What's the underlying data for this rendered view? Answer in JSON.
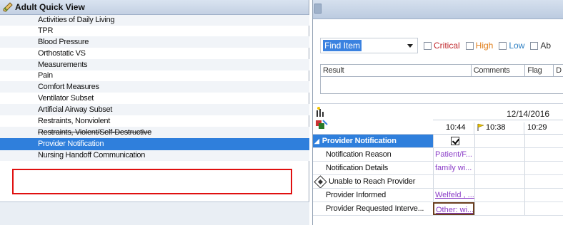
{
  "left_panel": {
    "title": "Adult Quick View",
    "items": [
      {
        "label": "Activities of Daily Living"
      },
      {
        "label": "TPR"
      },
      {
        "label": "Blood Pressure"
      },
      {
        "label": "Orthostatic VS"
      },
      {
        "label": "Measurements"
      },
      {
        "label": "Pain"
      },
      {
        "label": "Comfort Measures"
      },
      {
        "label": "Ventilator Subset"
      },
      {
        "label": "Artificial Airway Subset"
      },
      {
        "label": "Restraints, Nonviolent"
      },
      {
        "label": "Restraints, Violent/Self-Destructive"
      },
      {
        "label": "Provider Notification"
      },
      {
        "label": "Nursing Handoff Communication"
      }
    ],
    "selected_index": 11
  },
  "right_panel": {
    "find": {
      "value": "Find Item"
    },
    "filters": [
      "Critical",
      "High",
      "Low",
      "Ab"
    ],
    "result_columns": [
      "Result",
      "Comments",
      "Flag",
      "D"
    ],
    "grid": {
      "date": "12/14/2016",
      "times": [
        "10:44",
        "10:38",
        "10:29"
      ],
      "section": "Provider Notification",
      "rows": [
        {
          "label": "Notification Reason",
          "value": "Patient/F..."
        },
        {
          "label": "Notification Details",
          "value": "family wi..."
        },
        {
          "label": "Unable to Reach Provider",
          "value": ""
        },
        {
          "label": "Provider Informed",
          "value": "Welfeld , ..."
        },
        {
          "label": "Provider Requested Interve...",
          "value": "Other: wi..."
        }
      ]
    }
  },
  "colors": {
    "selection": "#2f7fdc",
    "highlight_box": "#e01010",
    "value_text": "#8a3bc7"
  }
}
